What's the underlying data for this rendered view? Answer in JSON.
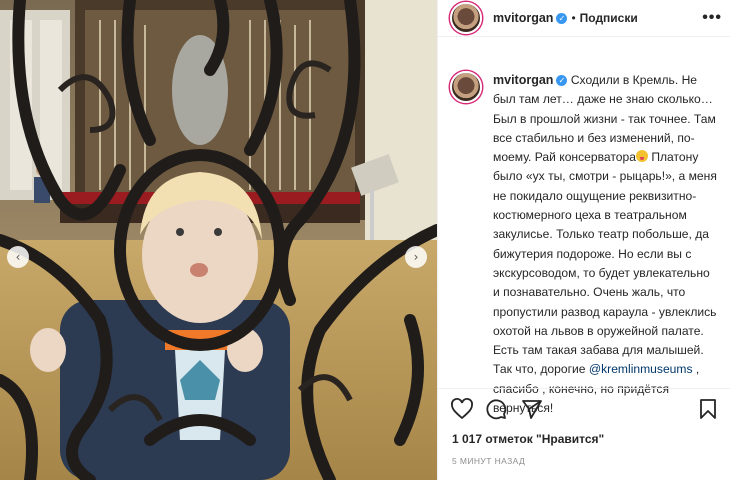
{
  "header": {
    "username": "mvitorgan",
    "verified_mark": "✓",
    "separator": "•",
    "follow_label": "Подписки",
    "more_label": "•••"
  },
  "caption": {
    "username": "mvitorgan",
    "text_part1": "Сходили в Кремль. Не был там лет… даже не знаю сколько… Был в прошлой жизни - так точнее. Там все стабильно и без изменений, по-моему. Рай консерватора",
    "emoji": "grinning-tongue-emoji",
    "text_part2": " Платону было «ух ты, смотри - рыцарь!», а меня не покидало ощущение реквизитно-костюмерного цеха в театральном закулисье. Только театр побольше, да бижутерия подороже. Но если вы с экскурсоводом, то будет увлекательно и познавательно. Очень жаль, что пропустили развод караула - увлеклись охотой на львов в оружейной палате. Есть там такая забава для малышей. Так что, дорогие ",
    "mention": "@kremlinmuseums",
    "text_part3": " , спасибо , конечно, но придётся вернуться!"
  },
  "media": {
    "prev_label": "‹",
    "next_label": "›"
  },
  "stats": {
    "likes": "1 017 отметок \"Нравится\"",
    "time": "5 МИНУТ НАЗАД"
  },
  "icons": [
    "heart-icon",
    "comment-icon",
    "share-icon",
    "bookmark-icon"
  ],
  "colors": {
    "link": "#00376b",
    "verified": "#3897f0",
    "ring": "#d62976"
  }
}
